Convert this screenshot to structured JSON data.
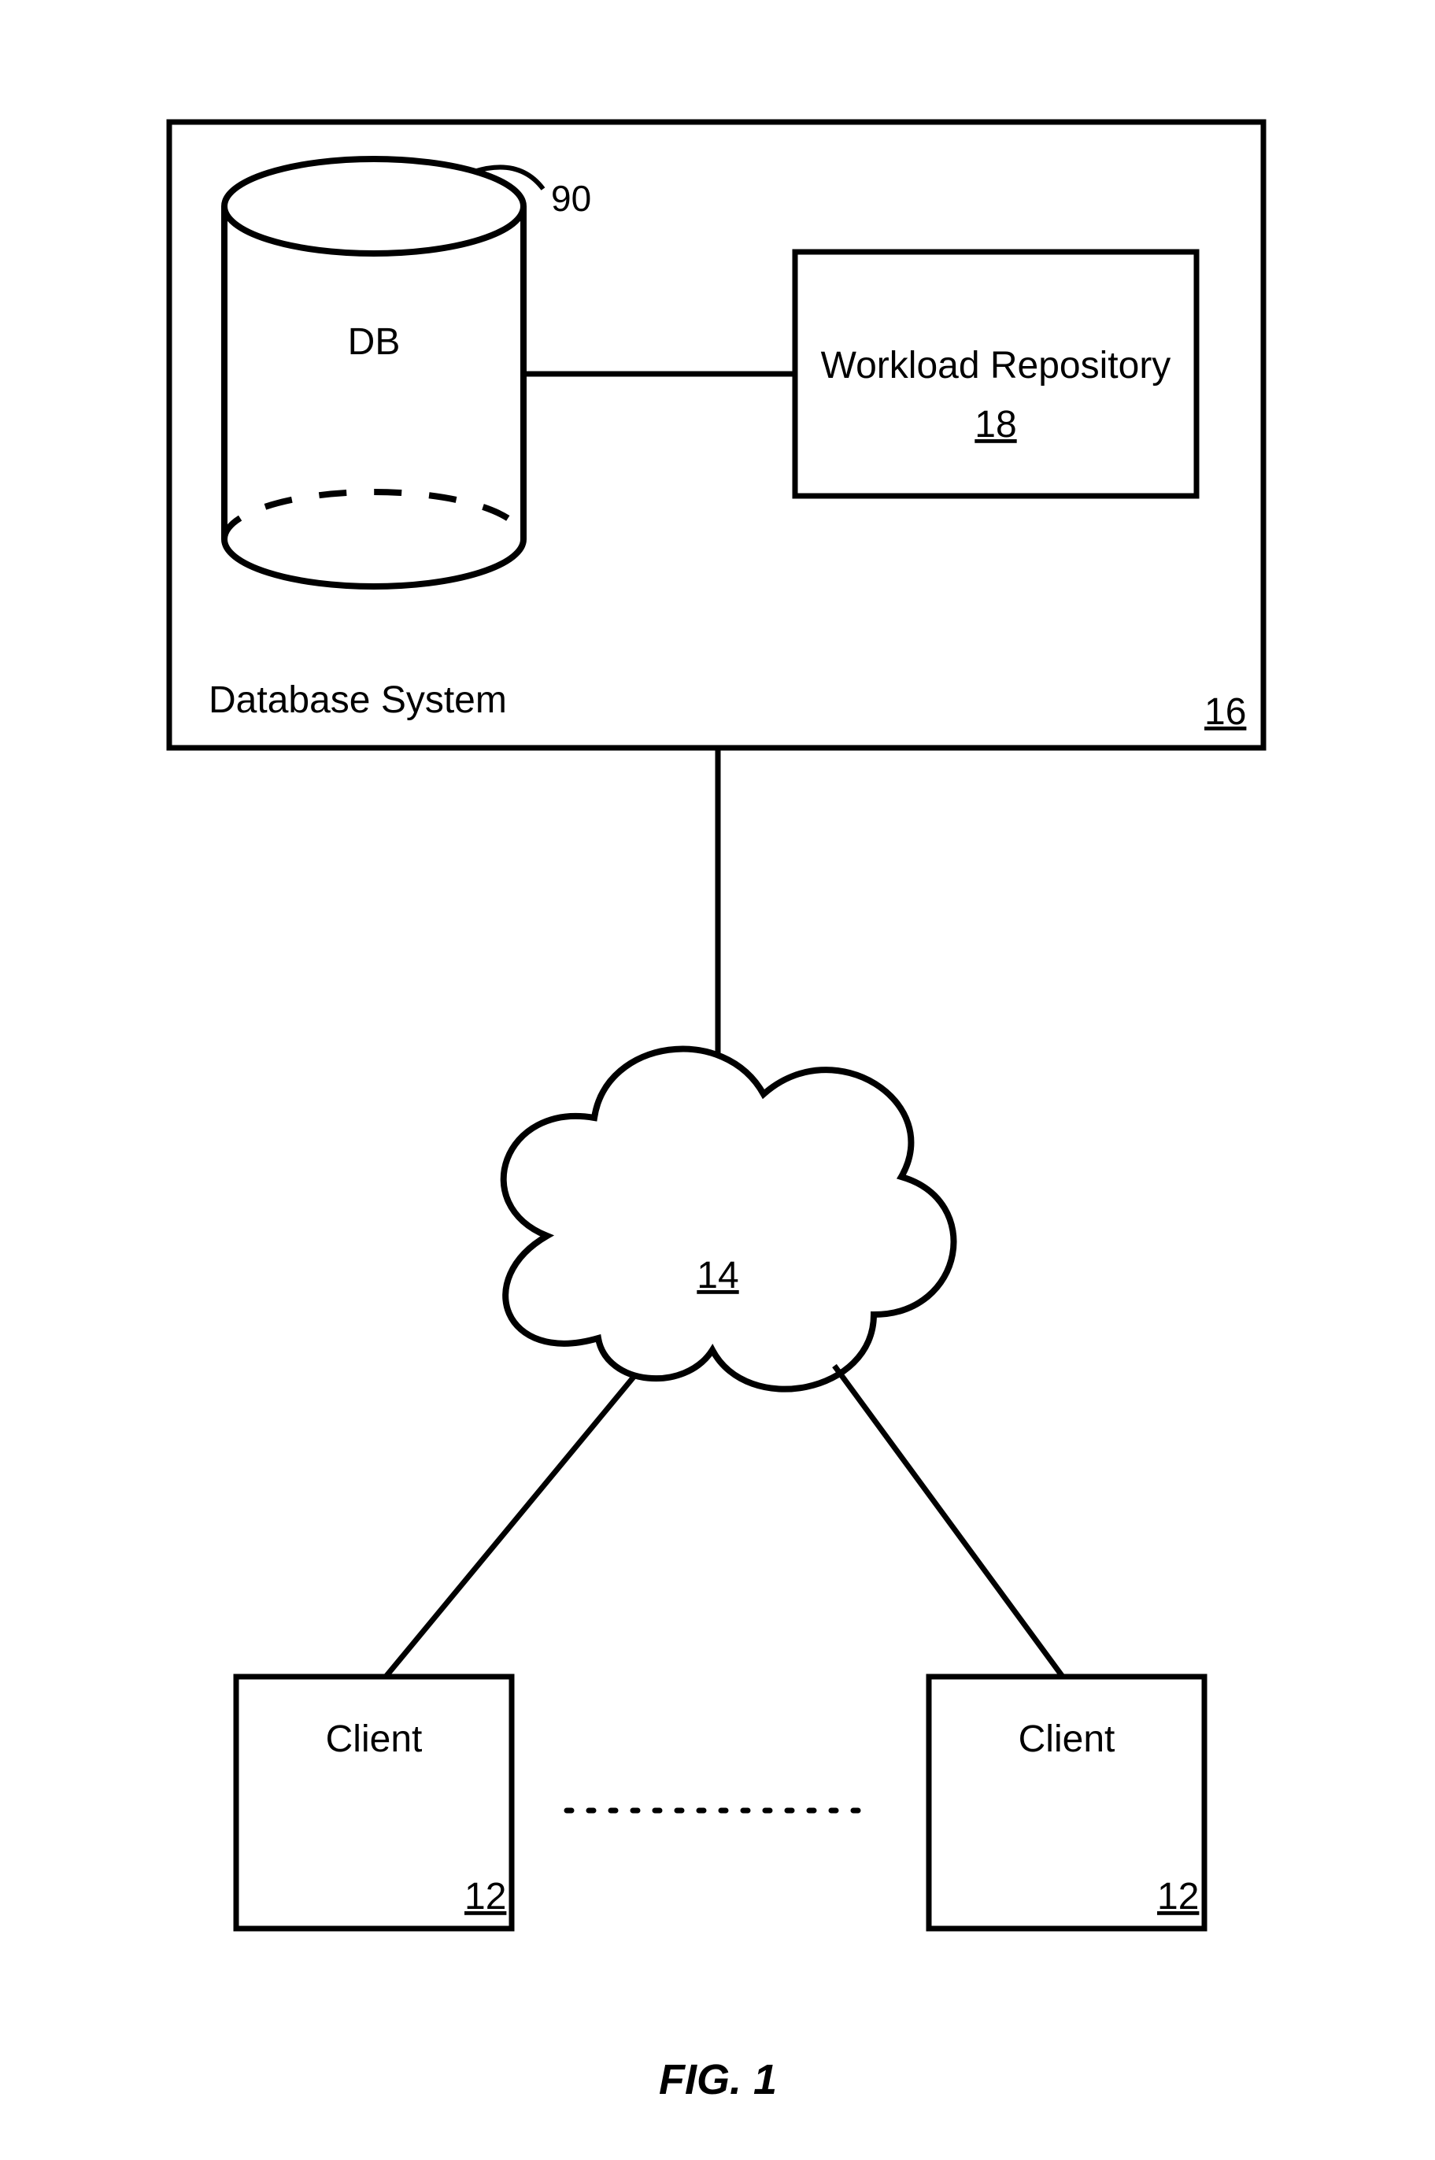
{
  "figure": {
    "caption": "FIG. 1"
  },
  "system": {
    "title": "Database System",
    "ref": "16"
  },
  "db": {
    "label": "DB",
    "ref": "90"
  },
  "workload": {
    "title_line1": "Workload Repository",
    "ref": "18"
  },
  "cloud": {
    "ref": "14"
  },
  "clients": {
    "left": {
      "label": "Client",
      "ref": "12"
    },
    "right": {
      "label": "Client",
      "ref": "12"
    }
  }
}
